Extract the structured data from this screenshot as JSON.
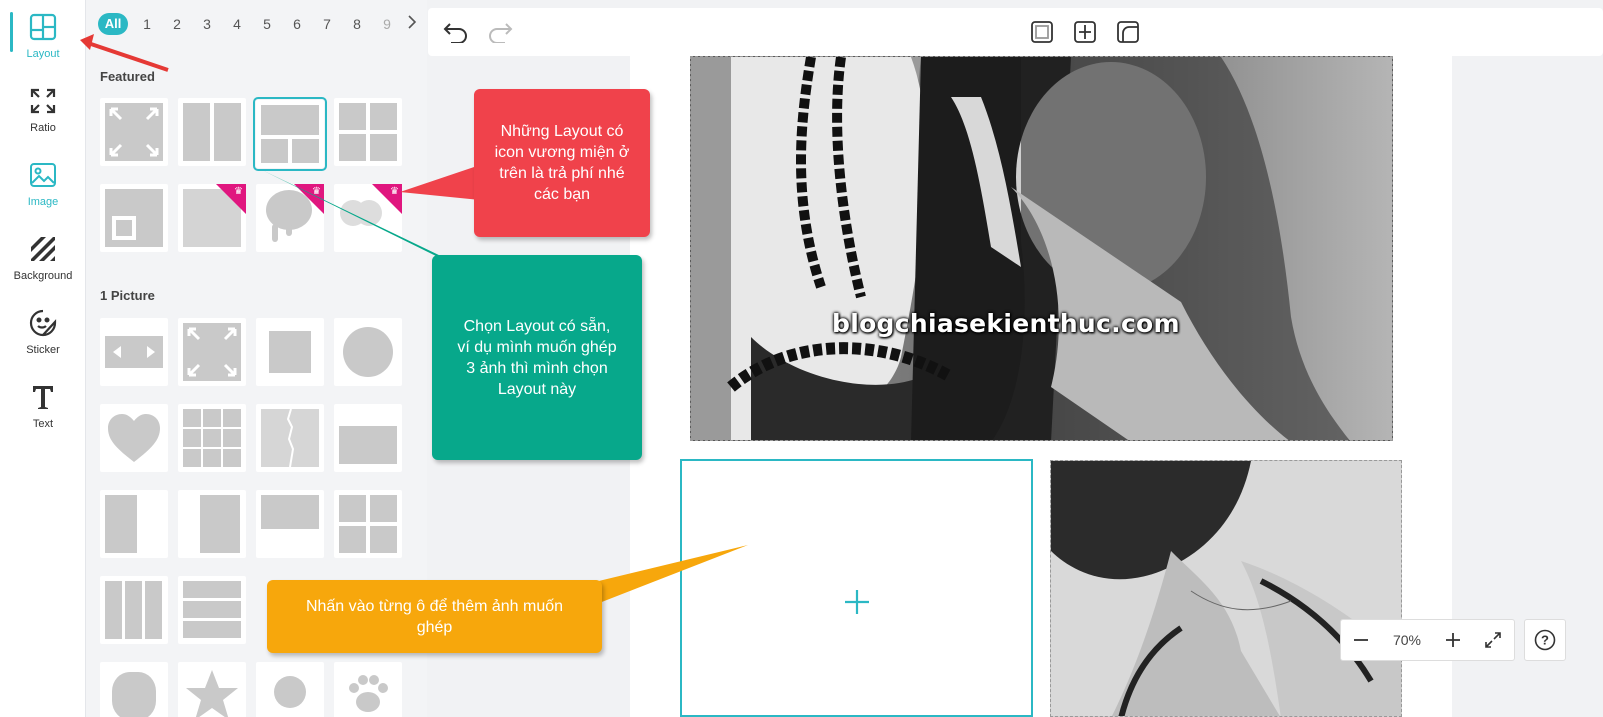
{
  "colors": {
    "accent": "#2bb8c4",
    "premium": "#e0167f",
    "callout_red": "#f0424b",
    "callout_green": "#07a88b",
    "callout_orange": "#f7a70c"
  },
  "rail": {
    "items": [
      {
        "label": "Layout",
        "icon": "layout-icon"
      },
      {
        "label": "Ratio",
        "icon": "ratio-icon"
      },
      {
        "label": "Image",
        "icon": "image-icon"
      },
      {
        "label": "Background",
        "icon": "background-icon"
      },
      {
        "label": "Sticker",
        "icon": "sticker-icon"
      },
      {
        "label": "Text",
        "icon": "text-icon"
      }
    ]
  },
  "pager": {
    "all": "All",
    "pages": [
      "1",
      "2",
      "3",
      "4",
      "5",
      "6",
      "7",
      "8",
      "9"
    ]
  },
  "sections": {
    "featured": "Featured",
    "one_picture": "1 Picture"
  },
  "watermark": "blogchiasekienthuc.com",
  "zoom": {
    "value": "70%"
  },
  "callouts": {
    "red": "Những Layout có icon vương miện ở trên là trả phí nhé các bạn",
    "green": "Chọn Layout có sẵn, ví dụ mình muốn ghép 3 ảnh thì mình chọn Layout này",
    "orange": "Nhấn vào từng ô để thêm ảnh muốn ghép"
  }
}
